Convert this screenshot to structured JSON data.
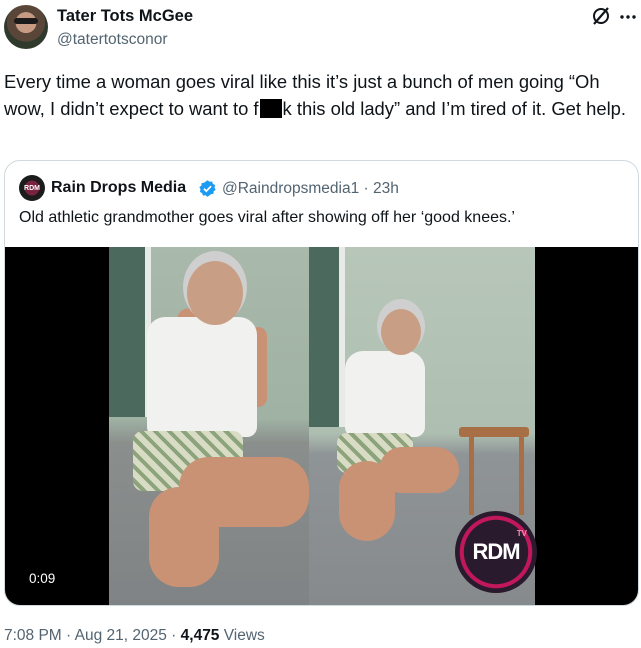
{
  "author": {
    "display_name": "Tater Tots McGee",
    "handle": "@tatertotsconor",
    "avatar_icon": "profile-avatar"
  },
  "tweet": {
    "text_before": "Every time a woman goes viral like this it’s just a bunch of men going “Oh wow, I didn’t expect to want to f",
    "text_after": "k this old lady” and I’m tired of it. Get help."
  },
  "quote": {
    "author_name": "Rain Drops Media",
    "verified_icon": "verified-badge-icon",
    "handle_and_time": "@Raindropsmedia1 · 23h",
    "avatar_label": "RDM",
    "text": "Old athletic grandmother goes viral after showing off her ‘good knees.’",
    "video": {
      "duration": "0:09",
      "watermark": "RDM",
      "watermark_sub": "TV"
    }
  },
  "footer": {
    "time_date": "7:08 PM · Aug 21, 2025 · ",
    "views_count": "4,475",
    "views_label": " Views"
  },
  "colors": {
    "text": "#0f1419",
    "secondary": "#536471",
    "border": "#cfd9de",
    "verified": "#1d9bf0"
  }
}
